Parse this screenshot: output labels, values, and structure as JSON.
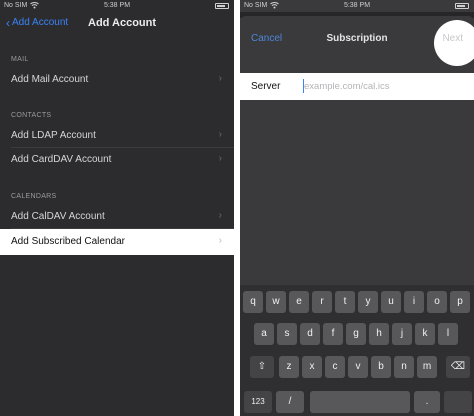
{
  "left": {
    "status": {
      "carrier": "No SIM",
      "time": "5:38 PM"
    },
    "nav": {
      "back_label": "Add Account",
      "title": "Add Account"
    },
    "sections": [
      {
        "header": "MAIL",
        "items": [
          "Add Mail Account"
        ]
      },
      {
        "header": "CONTACTS",
        "items": [
          "Add LDAP Account",
          "Add CardDAV Account"
        ]
      },
      {
        "header": "CALENDARS",
        "items": [
          "Add CalDAV Account",
          "Add Subscribed Calendar"
        ]
      }
    ]
  },
  "right": {
    "status": {
      "carrier": "No SIM",
      "time": "5:38 PM"
    },
    "sheet": {
      "cancel": "Cancel",
      "title": "Subscription",
      "next": "Next"
    },
    "server": {
      "label": "Server",
      "placeholder": "example.com/cal.ics",
      "value": ""
    },
    "keyboard": {
      "row1": [
        "q",
        "w",
        "e",
        "r",
        "t",
        "y",
        "u",
        "i",
        "o",
        "p"
      ],
      "row2": [
        "a",
        "s",
        "d",
        "f",
        "g",
        "h",
        "j",
        "k",
        "l"
      ],
      "row3": [
        "z",
        "x",
        "c",
        "v",
        "b",
        "n",
        "m"
      ],
      "row4": [
        "123",
        "/",
        "."
      ]
    }
  },
  "colors": {
    "accent": "#3a82f7",
    "highlight_row": "#ffffff",
    "background": "#2c2c2e"
  }
}
